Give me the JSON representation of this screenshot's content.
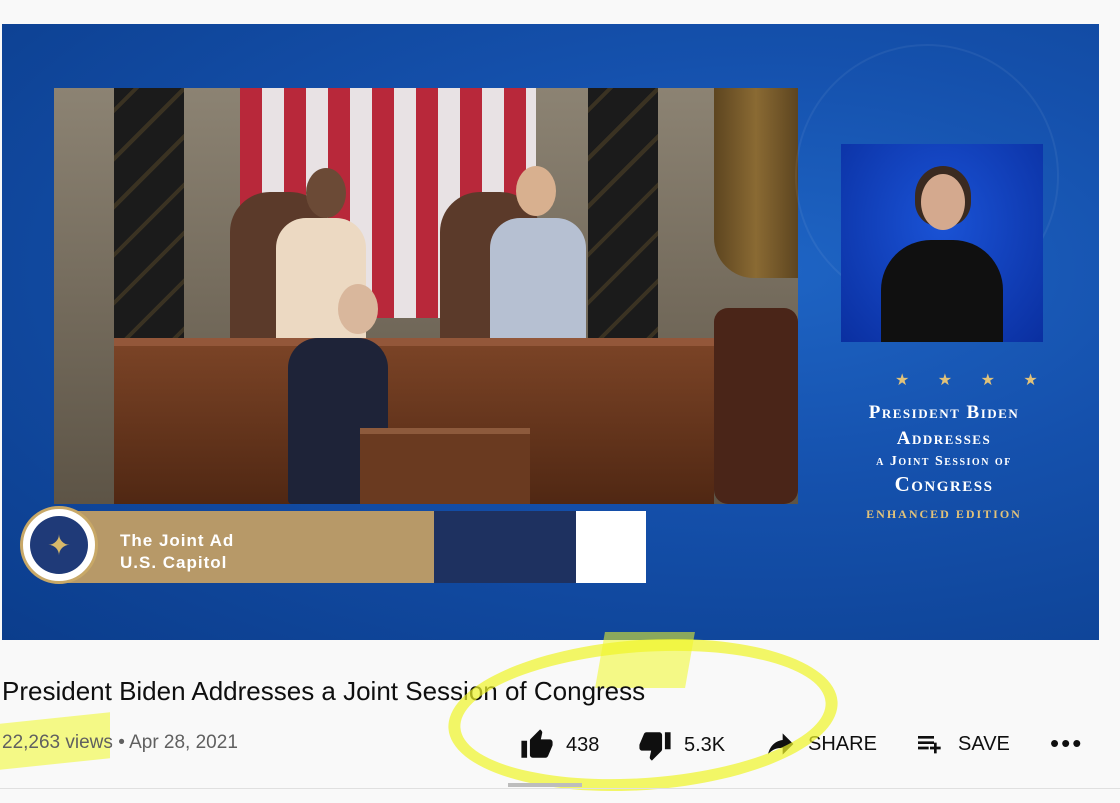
{
  "video": {
    "lower_third": {
      "line1": "The Joint Ad",
      "line2": "U.S. Capitol",
      "seal_icon": "eagle-seal-icon"
    },
    "title_card": {
      "stars": "★ ★ ★ ★",
      "line1": "President Biden",
      "line2": "Addresses",
      "line3": "a Joint Session of",
      "line4": "Congress",
      "line5": "ENHANCED EDITION"
    }
  },
  "meta": {
    "title": "President Biden Addresses a Joint Session of Congress",
    "views": "22,263 views",
    "date": "Apr 28, 2021",
    "likes": "438",
    "dislikes": "5.3K",
    "share_label": "SHARE",
    "save_label": "SAVE"
  },
  "colors": {
    "highlight": "#f0fa28",
    "accent_gold": "#e1c27a",
    "video_blue": "#1551ad"
  }
}
